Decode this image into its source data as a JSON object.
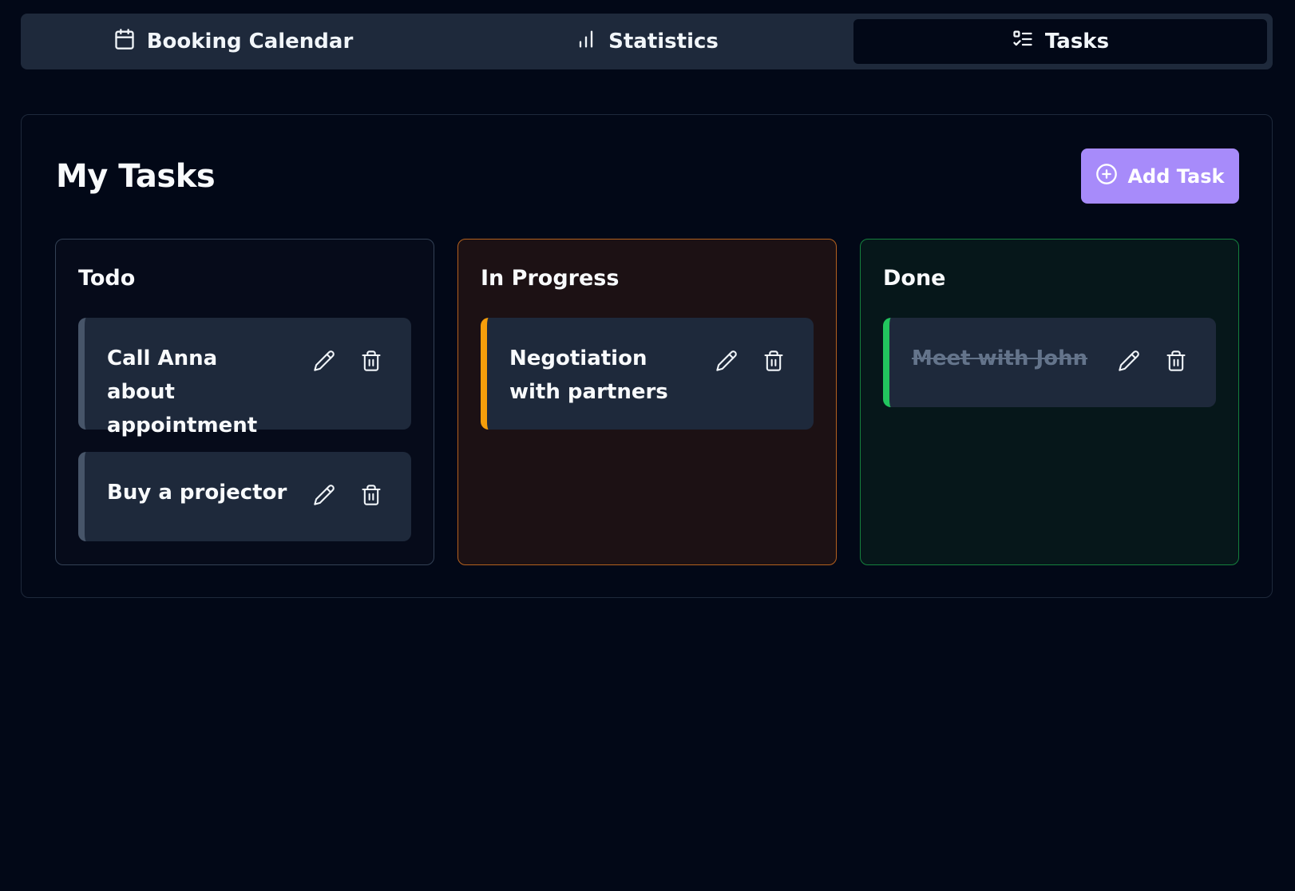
{
  "tabs": [
    {
      "label": "Booking Calendar",
      "icon": "calendar-icon",
      "active": false
    },
    {
      "label": "Statistics",
      "icon": "bar-chart-icon",
      "active": false
    },
    {
      "label": "Tasks",
      "icon": "list-checks-icon",
      "active": true
    }
  ],
  "main": {
    "title": "My Tasks",
    "add_button_label": "Add Task",
    "add_button_color": "#a78bfa"
  },
  "columns": [
    {
      "title": "Todo",
      "accent": "#475569",
      "cards": [
        {
          "text": "Call Anna about appointment"
        },
        {
          "text": "Buy a projector"
        }
      ]
    },
    {
      "title": "In Progress",
      "accent": "#f59e0b",
      "cards": [
        {
          "text": "Negotiation with partners"
        }
      ]
    },
    {
      "title": "Done",
      "accent": "#22c55e",
      "cards": [
        {
          "text": "Meet with John",
          "completed": true
        }
      ]
    }
  ]
}
